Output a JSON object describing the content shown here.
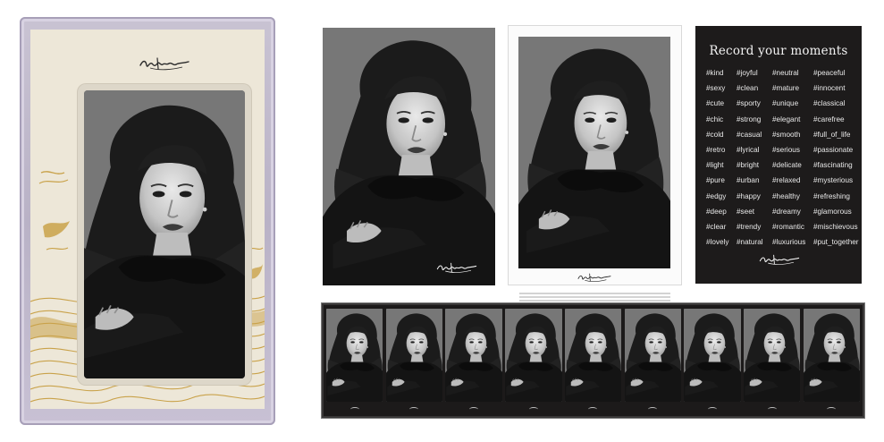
{
  "card": {
    "title": "Record your moments",
    "tags": [
      "#kind",
      "#joyful",
      "#neutral",
      "#peaceful",
      "#sexy",
      "#clean",
      "#mature",
      "#innocent",
      "#cute",
      "#sporty",
      "#unique",
      "#classical",
      "#chic",
      "#strong",
      "#elegant",
      "#carefree",
      "#cold",
      "#casual",
      "#smooth",
      "#full_of_life",
      "#retro",
      "#lyrical",
      "#serious",
      "#passionate",
      "#light",
      "#bright",
      "#delicate",
      "#fascinating",
      "#pure",
      "#urban",
      "#relaxed",
      "#mysterious",
      "#edgy",
      "#happy",
      "#healthy",
      "#refreshing",
      "#deep",
      "#seet",
      "#dreamy",
      "#glamorous",
      "#clear",
      "#trendy",
      "#romantic",
      "#mischievous",
      "#lovely",
      "#natural",
      "#luxurious",
      "#put_together"
    ]
  },
  "film_strip": {
    "frame_count": 9
  },
  "colors": {
    "case_frame": "#c3bccf",
    "case_paper": "#ede7d8",
    "gold": "#c9a24a",
    "card_bg": "#1d1b1b",
    "strip_bg": "#1c1a1a"
  },
  "icons": {
    "signature": "handwritten-signature"
  }
}
